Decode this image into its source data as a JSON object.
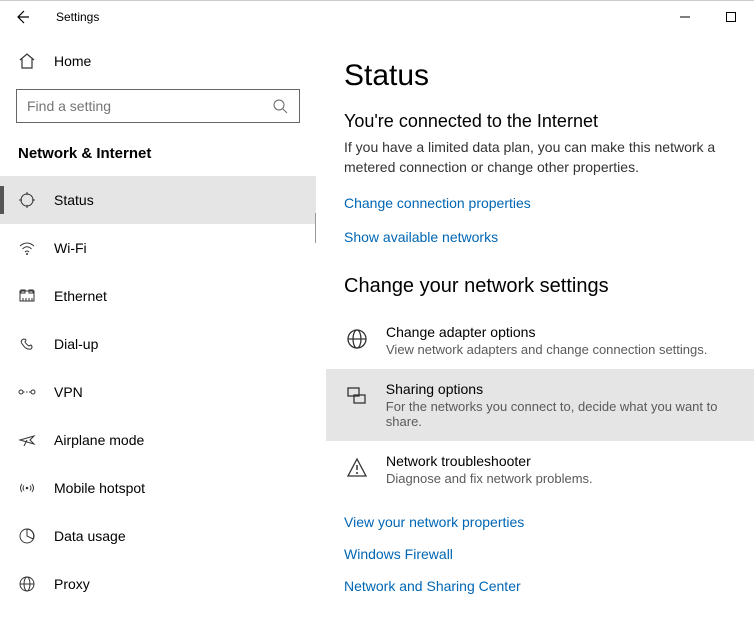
{
  "window": {
    "title": "Settings"
  },
  "sidebar": {
    "home": "Home",
    "search_placeholder": "Find a setting",
    "category": "Network & Internet",
    "items": [
      {
        "label": "Status",
        "icon": "status"
      },
      {
        "label": "Wi-Fi",
        "icon": "wifi"
      },
      {
        "label": "Ethernet",
        "icon": "ethernet"
      },
      {
        "label": "Dial-up",
        "icon": "dialup"
      },
      {
        "label": "VPN",
        "icon": "vpn"
      },
      {
        "label": "Airplane mode",
        "icon": "airplane"
      },
      {
        "label": "Mobile hotspot",
        "icon": "hotspot"
      },
      {
        "label": "Data usage",
        "icon": "datausage"
      },
      {
        "label": "Proxy",
        "icon": "proxy"
      }
    ]
  },
  "main": {
    "title": "Status",
    "connected_heading": "You're connected to the Internet",
    "connected_body": "If you have a limited data plan, you can make this network a metered connection or change other properties.",
    "link_change_props": "Change connection properties",
    "link_show_networks": "Show available networks",
    "section_heading": "Change your network settings",
    "cards": [
      {
        "title": "Change adapter options",
        "desc": "View network adapters and change connection settings."
      },
      {
        "title": "Sharing options",
        "desc": "For the networks you connect to, decide what you want to share."
      },
      {
        "title": "Network troubleshooter",
        "desc": "Diagnose and fix network problems."
      }
    ],
    "link_view_props": "View your network properties",
    "link_firewall": "Windows Firewall",
    "link_sharing_center": "Network and Sharing Center"
  }
}
